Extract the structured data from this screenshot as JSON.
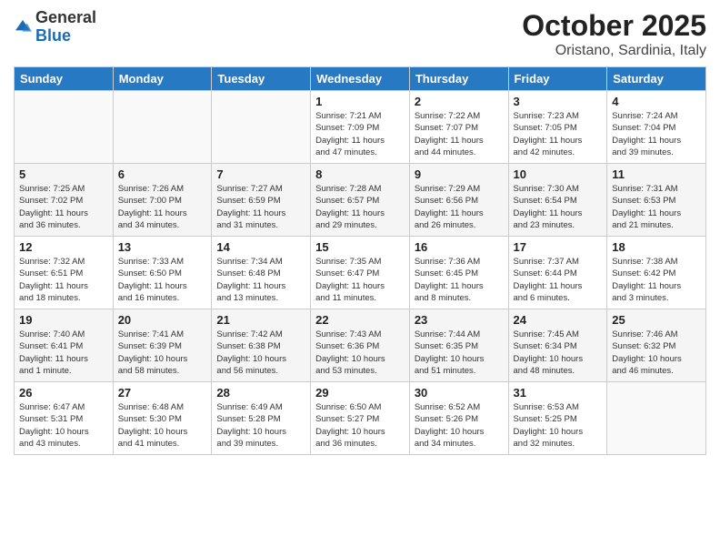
{
  "header": {
    "logo_general": "General",
    "logo_blue": "Blue",
    "month_title": "October 2025",
    "subtitle": "Oristano, Sardinia, Italy"
  },
  "days_of_week": [
    "Sunday",
    "Monday",
    "Tuesday",
    "Wednesday",
    "Thursday",
    "Friday",
    "Saturday"
  ],
  "weeks": [
    [
      {
        "day": "",
        "info": ""
      },
      {
        "day": "",
        "info": ""
      },
      {
        "day": "",
        "info": ""
      },
      {
        "day": "1",
        "info": "Sunrise: 7:21 AM\nSunset: 7:09 PM\nDaylight: 11 hours\nand 47 minutes."
      },
      {
        "day": "2",
        "info": "Sunrise: 7:22 AM\nSunset: 7:07 PM\nDaylight: 11 hours\nand 44 minutes."
      },
      {
        "day": "3",
        "info": "Sunrise: 7:23 AM\nSunset: 7:05 PM\nDaylight: 11 hours\nand 42 minutes."
      },
      {
        "day": "4",
        "info": "Sunrise: 7:24 AM\nSunset: 7:04 PM\nDaylight: 11 hours\nand 39 minutes."
      }
    ],
    [
      {
        "day": "5",
        "info": "Sunrise: 7:25 AM\nSunset: 7:02 PM\nDaylight: 11 hours\nand 36 minutes."
      },
      {
        "day": "6",
        "info": "Sunrise: 7:26 AM\nSunset: 7:00 PM\nDaylight: 11 hours\nand 34 minutes."
      },
      {
        "day": "7",
        "info": "Sunrise: 7:27 AM\nSunset: 6:59 PM\nDaylight: 11 hours\nand 31 minutes."
      },
      {
        "day": "8",
        "info": "Sunrise: 7:28 AM\nSunset: 6:57 PM\nDaylight: 11 hours\nand 29 minutes."
      },
      {
        "day": "9",
        "info": "Sunrise: 7:29 AM\nSunset: 6:56 PM\nDaylight: 11 hours\nand 26 minutes."
      },
      {
        "day": "10",
        "info": "Sunrise: 7:30 AM\nSunset: 6:54 PM\nDaylight: 11 hours\nand 23 minutes."
      },
      {
        "day": "11",
        "info": "Sunrise: 7:31 AM\nSunset: 6:53 PM\nDaylight: 11 hours\nand 21 minutes."
      }
    ],
    [
      {
        "day": "12",
        "info": "Sunrise: 7:32 AM\nSunset: 6:51 PM\nDaylight: 11 hours\nand 18 minutes."
      },
      {
        "day": "13",
        "info": "Sunrise: 7:33 AM\nSunset: 6:50 PM\nDaylight: 11 hours\nand 16 minutes."
      },
      {
        "day": "14",
        "info": "Sunrise: 7:34 AM\nSunset: 6:48 PM\nDaylight: 11 hours\nand 13 minutes."
      },
      {
        "day": "15",
        "info": "Sunrise: 7:35 AM\nSunset: 6:47 PM\nDaylight: 11 hours\nand 11 minutes."
      },
      {
        "day": "16",
        "info": "Sunrise: 7:36 AM\nSunset: 6:45 PM\nDaylight: 11 hours\nand 8 minutes."
      },
      {
        "day": "17",
        "info": "Sunrise: 7:37 AM\nSunset: 6:44 PM\nDaylight: 11 hours\nand 6 minutes."
      },
      {
        "day": "18",
        "info": "Sunrise: 7:38 AM\nSunset: 6:42 PM\nDaylight: 11 hours\nand 3 minutes."
      }
    ],
    [
      {
        "day": "19",
        "info": "Sunrise: 7:40 AM\nSunset: 6:41 PM\nDaylight: 11 hours\nand 1 minute."
      },
      {
        "day": "20",
        "info": "Sunrise: 7:41 AM\nSunset: 6:39 PM\nDaylight: 10 hours\nand 58 minutes."
      },
      {
        "day": "21",
        "info": "Sunrise: 7:42 AM\nSunset: 6:38 PM\nDaylight: 10 hours\nand 56 minutes."
      },
      {
        "day": "22",
        "info": "Sunrise: 7:43 AM\nSunset: 6:36 PM\nDaylight: 10 hours\nand 53 minutes."
      },
      {
        "day": "23",
        "info": "Sunrise: 7:44 AM\nSunset: 6:35 PM\nDaylight: 10 hours\nand 51 minutes."
      },
      {
        "day": "24",
        "info": "Sunrise: 7:45 AM\nSunset: 6:34 PM\nDaylight: 10 hours\nand 48 minutes."
      },
      {
        "day": "25",
        "info": "Sunrise: 7:46 AM\nSunset: 6:32 PM\nDaylight: 10 hours\nand 46 minutes."
      }
    ],
    [
      {
        "day": "26",
        "info": "Sunrise: 6:47 AM\nSunset: 5:31 PM\nDaylight: 10 hours\nand 43 minutes."
      },
      {
        "day": "27",
        "info": "Sunrise: 6:48 AM\nSunset: 5:30 PM\nDaylight: 10 hours\nand 41 minutes."
      },
      {
        "day": "28",
        "info": "Sunrise: 6:49 AM\nSunset: 5:28 PM\nDaylight: 10 hours\nand 39 minutes."
      },
      {
        "day": "29",
        "info": "Sunrise: 6:50 AM\nSunset: 5:27 PM\nDaylight: 10 hours\nand 36 minutes."
      },
      {
        "day": "30",
        "info": "Sunrise: 6:52 AM\nSunset: 5:26 PM\nDaylight: 10 hours\nand 34 minutes."
      },
      {
        "day": "31",
        "info": "Sunrise: 6:53 AM\nSunset: 5:25 PM\nDaylight: 10 hours\nand 32 minutes."
      },
      {
        "day": "",
        "info": ""
      }
    ]
  ]
}
